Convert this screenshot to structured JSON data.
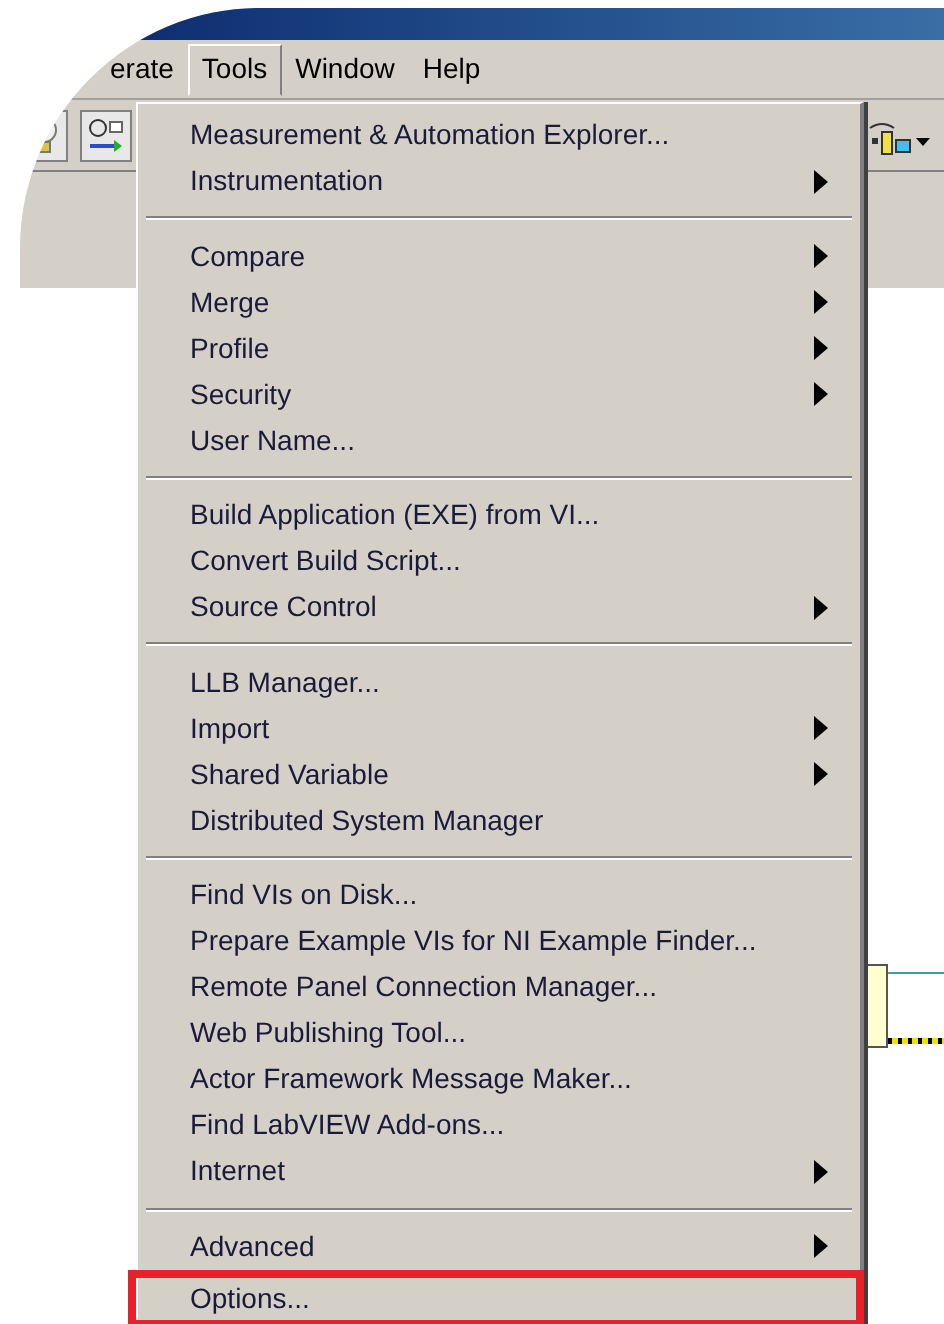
{
  "menu_bar": [
    {
      "label": "erate",
      "selected": false
    },
    {
      "label": "Tools",
      "selected": true
    },
    {
      "label": "Window",
      "selected": false
    },
    {
      "label": "Help",
      "selected": false
    }
  ],
  "tools_menu": {
    "sections": [
      {
        "items": [
          {
            "label": "Measurement & Automation Explorer...",
            "submenu": false,
            "highlighted": false
          },
          {
            "label": "Instrumentation",
            "submenu": true,
            "highlighted": false
          }
        ]
      },
      {
        "items": [
          {
            "label": "Compare",
            "submenu": true,
            "highlighted": false
          },
          {
            "label": "Merge",
            "submenu": true,
            "highlighted": false
          },
          {
            "label": "Profile",
            "submenu": true,
            "highlighted": false
          },
          {
            "label": "Security",
            "submenu": true,
            "highlighted": false
          },
          {
            "label": "User Name...",
            "submenu": false,
            "highlighted": false
          }
        ]
      },
      {
        "items": [
          {
            "label": "Build Application (EXE) from VI...",
            "submenu": false,
            "highlighted": false
          },
          {
            "label": "Convert Build Script...",
            "submenu": false,
            "highlighted": false
          },
          {
            "label": "Source Control",
            "submenu": true,
            "highlighted": false
          }
        ]
      },
      {
        "items": [
          {
            "label": "LLB Manager...",
            "submenu": false,
            "highlighted": false
          },
          {
            "label": "Import",
            "submenu": true,
            "highlighted": false
          },
          {
            "label": "Shared Variable",
            "submenu": true,
            "highlighted": false
          },
          {
            "label": "Distributed System Manager",
            "submenu": false,
            "highlighted": false
          }
        ]
      },
      {
        "items": [
          {
            "label": "Find VIs on Disk...",
            "submenu": false,
            "highlighted": false
          },
          {
            "label": "Prepare Example VIs for NI Example Finder...",
            "submenu": false,
            "highlighted": false
          },
          {
            "label": "Remote Panel Connection Manager...",
            "submenu": false,
            "highlighted": false
          },
          {
            "label": "Web Publishing Tool...",
            "submenu": false,
            "highlighted": false
          },
          {
            "label": "Actor Framework Message Maker...",
            "submenu": false,
            "highlighted": false
          },
          {
            "label": "Find LabVIEW Add-ons...",
            "submenu": false,
            "highlighted": false
          },
          {
            "label": "Internet",
            "submenu": true,
            "highlighted": false
          }
        ]
      },
      {
        "items": [
          {
            "label": "Advanced",
            "submenu": true,
            "highlighted": false
          },
          {
            "label": "Options...",
            "submenu": false,
            "highlighted": true
          }
        ]
      }
    ]
  }
}
